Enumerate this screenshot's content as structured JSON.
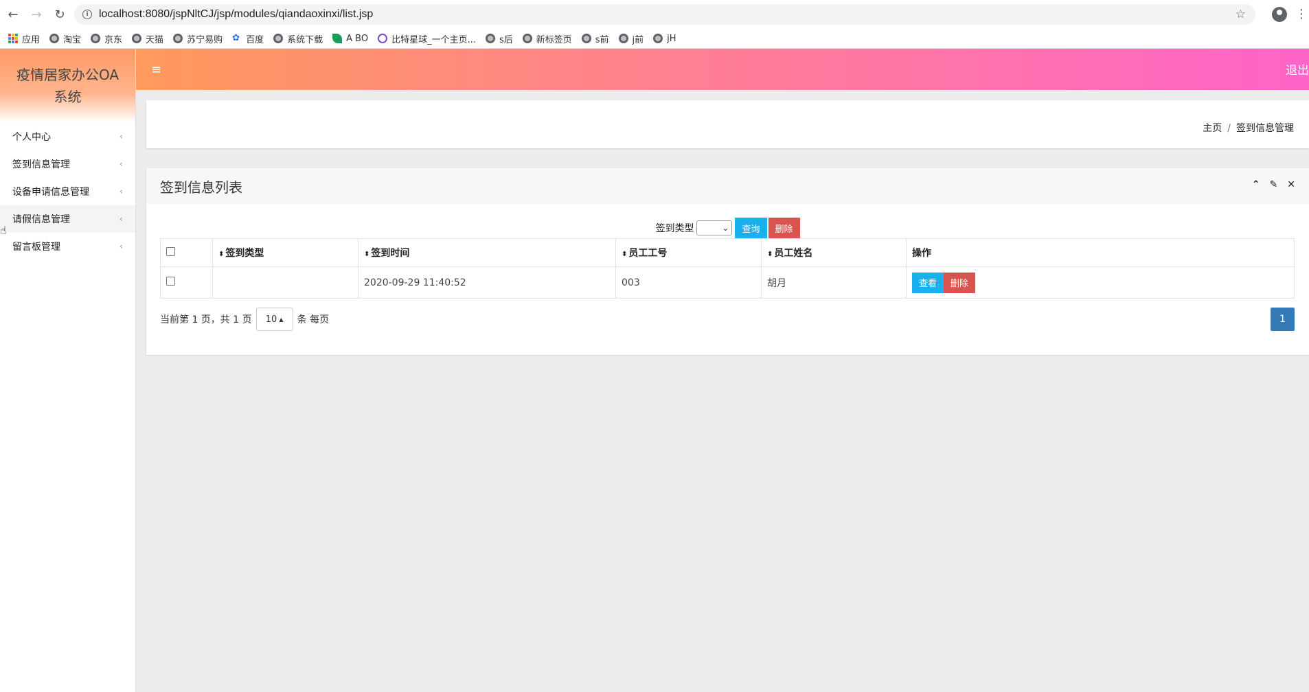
{
  "browser": {
    "url": "localhost:8080/jspNltCJ/jsp/modules/qiandaoxinxi/list.jsp",
    "bookmarks": [
      "应用",
      "淘宝",
      "京东",
      "天猫",
      "苏宁易购",
      "百度",
      "系统下载",
      "A BO",
      "比特星球_一个主页...",
      "s后",
      "新标签页",
      "s前",
      "j前",
      "jH"
    ]
  },
  "app": {
    "title": "疫情居家办公OA系统",
    "logout": "退出",
    "menu": [
      {
        "label": "个人中心"
      },
      {
        "label": "签到信息管理"
      },
      {
        "label": "设备申请信息管理"
      },
      {
        "label": "请假信息管理"
      },
      {
        "label": "留言板管理"
      }
    ]
  },
  "breadcrumb": {
    "home": "主页",
    "sep": "/",
    "current": "签到信息管理"
  },
  "list": {
    "title": "签到信息列表",
    "filter_label": "签到类型",
    "query_button": "查询",
    "delete_button": "删除",
    "columns": [
      "签到类型",
      "签到时间",
      "员工工号",
      "员工姓名",
      "操作"
    ],
    "rows": [
      {
        "type": "",
        "time": "2020-09-29 11:40:52",
        "emp_no": "003",
        "emp_name": "胡月",
        "view": "查看",
        "delete": "删除"
      }
    ],
    "pager": {
      "summary": "当前第 1 页，共 1 页",
      "page_size": "10",
      "suffix": "条 每页",
      "current_page": "1"
    }
  },
  "colors": {
    "topbar_start": "#ff9a5c",
    "topbar_end": "#ff64c9",
    "primary": "#1ab0f0",
    "danger": "#d9534f",
    "page_active": "#337ab7"
  }
}
